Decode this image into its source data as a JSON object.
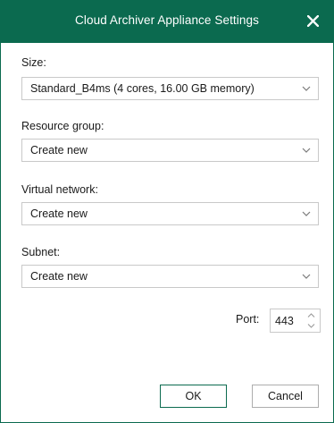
{
  "dialog": {
    "title": "Cloud Archiver Appliance Settings"
  },
  "fields": {
    "size": {
      "label": "Size:",
      "value": "Standard_B4ms (4 cores, 16.00 GB memory)"
    },
    "resource_group": {
      "label": "Resource group:",
      "value": "Create new"
    },
    "virtual_network": {
      "label": "Virtual network:",
      "value": "Create new"
    },
    "subnet": {
      "label": "Subnet:",
      "value": "Create new"
    },
    "port": {
      "label": "Port:",
      "value": "443"
    }
  },
  "buttons": {
    "ok": "OK",
    "cancel": "Cancel"
  },
  "colors": {
    "titlebar": "#0b6a4f",
    "title_text": "#ffffff"
  }
}
